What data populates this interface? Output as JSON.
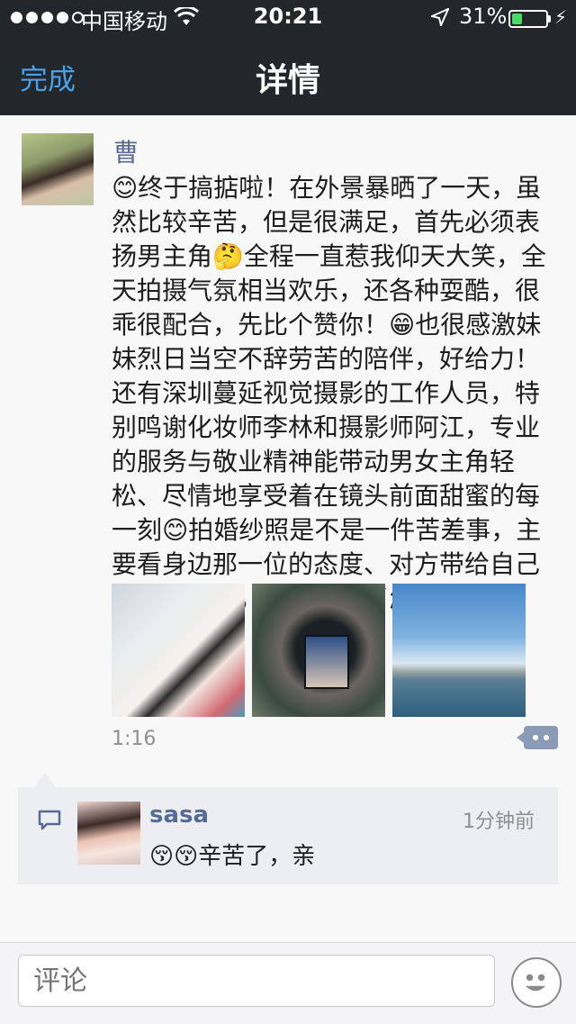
{
  "status_bar": {
    "carrier": "中国移动",
    "time": "20:21",
    "battery": "31%",
    "battery_level": 0.31
  },
  "nav": {
    "done_label": "完成",
    "title": "详情"
  },
  "post": {
    "author": "曹",
    "text": "😊终于搞掂啦！在外景暴晒了一天，虽然比较辛苦，但是很满足，首先必须表扬男主角🤔全程一直惹我仰天大笑，全天拍摄气氛相当欢乐，还各种耍酷，很乖很配合，先比个赞你！😁也很感激妹妹烈日当空不辞劳苦的陪伴，好给力！还有深圳蔓延视觉摄影的工作人员，特别鸣谢化妆师李林和摄影师阿江，专业的服务与敬业精神能带动男女主角轻松、尽情地享受着在镜头前面甜蜜的每一刻😊拍婚纱照是不是一件苦差事，主要看身边那一位的态度、对方带给自己怎样的心情，以及相信了怎样的团队。",
    "time": "1:16",
    "photos": [
      "bride-photo",
      "camera-screen-photo",
      "harbor-photo"
    ]
  },
  "comments": [
    {
      "user": "sasa",
      "time": "1分钟前",
      "text": "😚😚辛苦了，亲"
    }
  ],
  "input": {
    "placeholder": "评论"
  },
  "colors": {
    "nav_bg": "#21272a",
    "link": "#4ba0e8",
    "username": "#576b95",
    "comment_bg": "#eceef2"
  }
}
